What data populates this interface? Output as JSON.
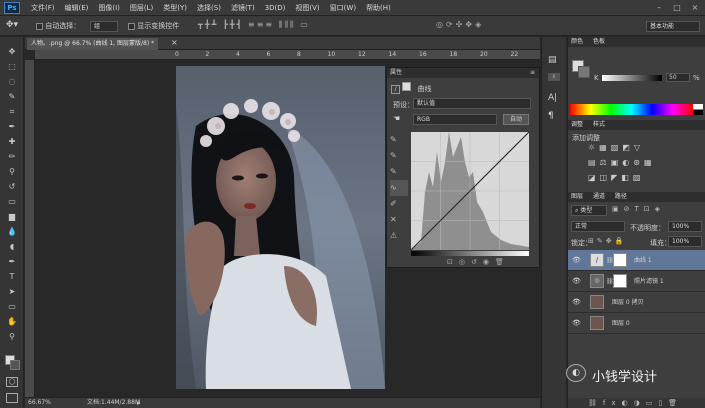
{
  "menubar": {
    "logo": "Ps",
    "items": [
      "文件(F)",
      "编辑(E)",
      "图像(I)",
      "图层(L)",
      "类型(Y)",
      "选择(S)",
      "滤镜(T)",
      "3D(D)",
      "视图(V)",
      "窗口(W)",
      "帮助(H)"
    ]
  },
  "options": {
    "auto_select": "自动选择：",
    "target": "组",
    "show_transform": "显示变换控件",
    "workspace": "基本功能"
  },
  "doc": {
    "tab": "人物。.png @ 66.7% (曲线 1, 图层蒙版/8) *",
    "zoom": "66.67%",
    "file_info": "文档:1.44M/2.88M"
  },
  "ruler": {
    "ticks": [
      "0",
      "2",
      "4",
      "6",
      "8",
      "10",
      "12",
      "14",
      "16",
      "18",
      "20",
      "22",
      "24"
    ]
  },
  "props": {
    "title": "属性",
    "mode_label": "曲线",
    "preset_label": "预设：",
    "preset_value": "默认值",
    "channel_value": "RGB",
    "auto_button": "自动"
  },
  "color_panel": {
    "tabs": [
      "颜色",
      "色板"
    ],
    "k_label": "K",
    "k_value": "50",
    "k_unit": "%"
  },
  "adjust_panel": {
    "tabs": [
      "调整",
      "样式"
    ],
    "title": "添加调整"
  },
  "layers_panel": {
    "tabs": [
      "图层",
      "通道",
      "路径"
    ],
    "filter": "类型",
    "blend": "正常",
    "opacity_label": "不透明度：",
    "opacity": "100%",
    "lock_label": "锁定：",
    "fill_label": "填充：",
    "fill": "100%",
    "layers": [
      {
        "name": "曲线 1",
        "selected": true
      },
      {
        "name": "照片滤镜 1",
        "selected": false
      },
      {
        "name": "图层 0 拷贝",
        "selected": false
      },
      {
        "name": "图层 0",
        "selected": false
      }
    ]
  },
  "watermark": "小钱学设计"
}
